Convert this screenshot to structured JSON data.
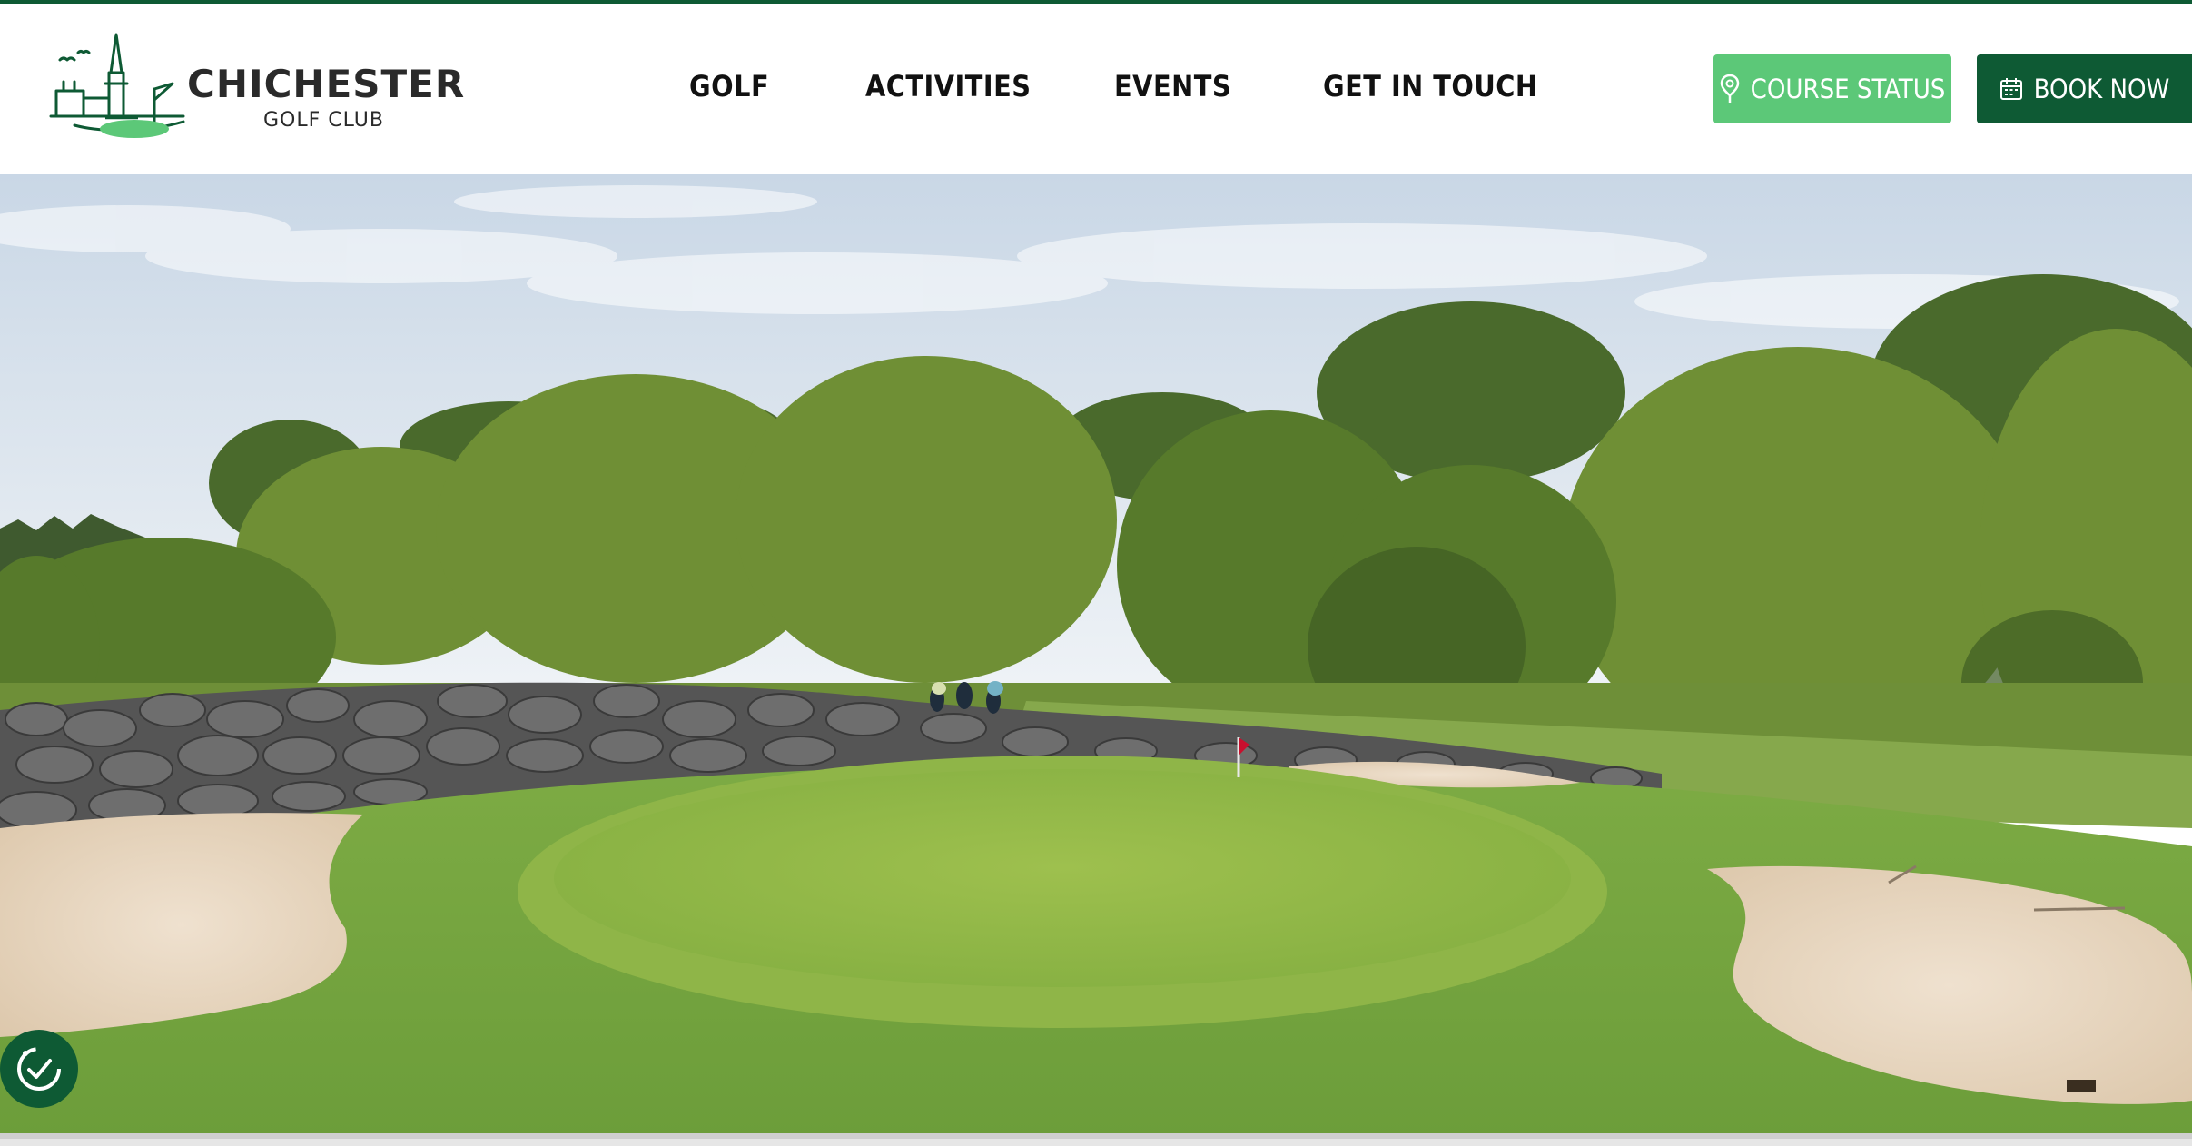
{
  "brand": {
    "title": "CHICHESTER",
    "subtitle": "GOLF CLUB"
  },
  "nav": {
    "items": [
      {
        "label": "GOLF"
      },
      {
        "label": "ACTIVITIES"
      },
      {
        "label": "EVENTS"
      },
      {
        "label": "GET IN TOUCH"
      }
    ]
  },
  "actions": {
    "course_status": {
      "label": "COURSE STATUS",
      "icon": "map-pin-icon"
    },
    "book_now": {
      "label": "BOOK NOW",
      "icon": "calendar-icon"
    }
  },
  "hero": {
    "alt": "Golf green with bunkers, rock wall and willow trees"
  },
  "accessibility": {
    "icon": "accessibility-icon"
  },
  "colors": {
    "brand_dark_green": "#0e5a34",
    "brand_light_green": "#5cc878"
  }
}
